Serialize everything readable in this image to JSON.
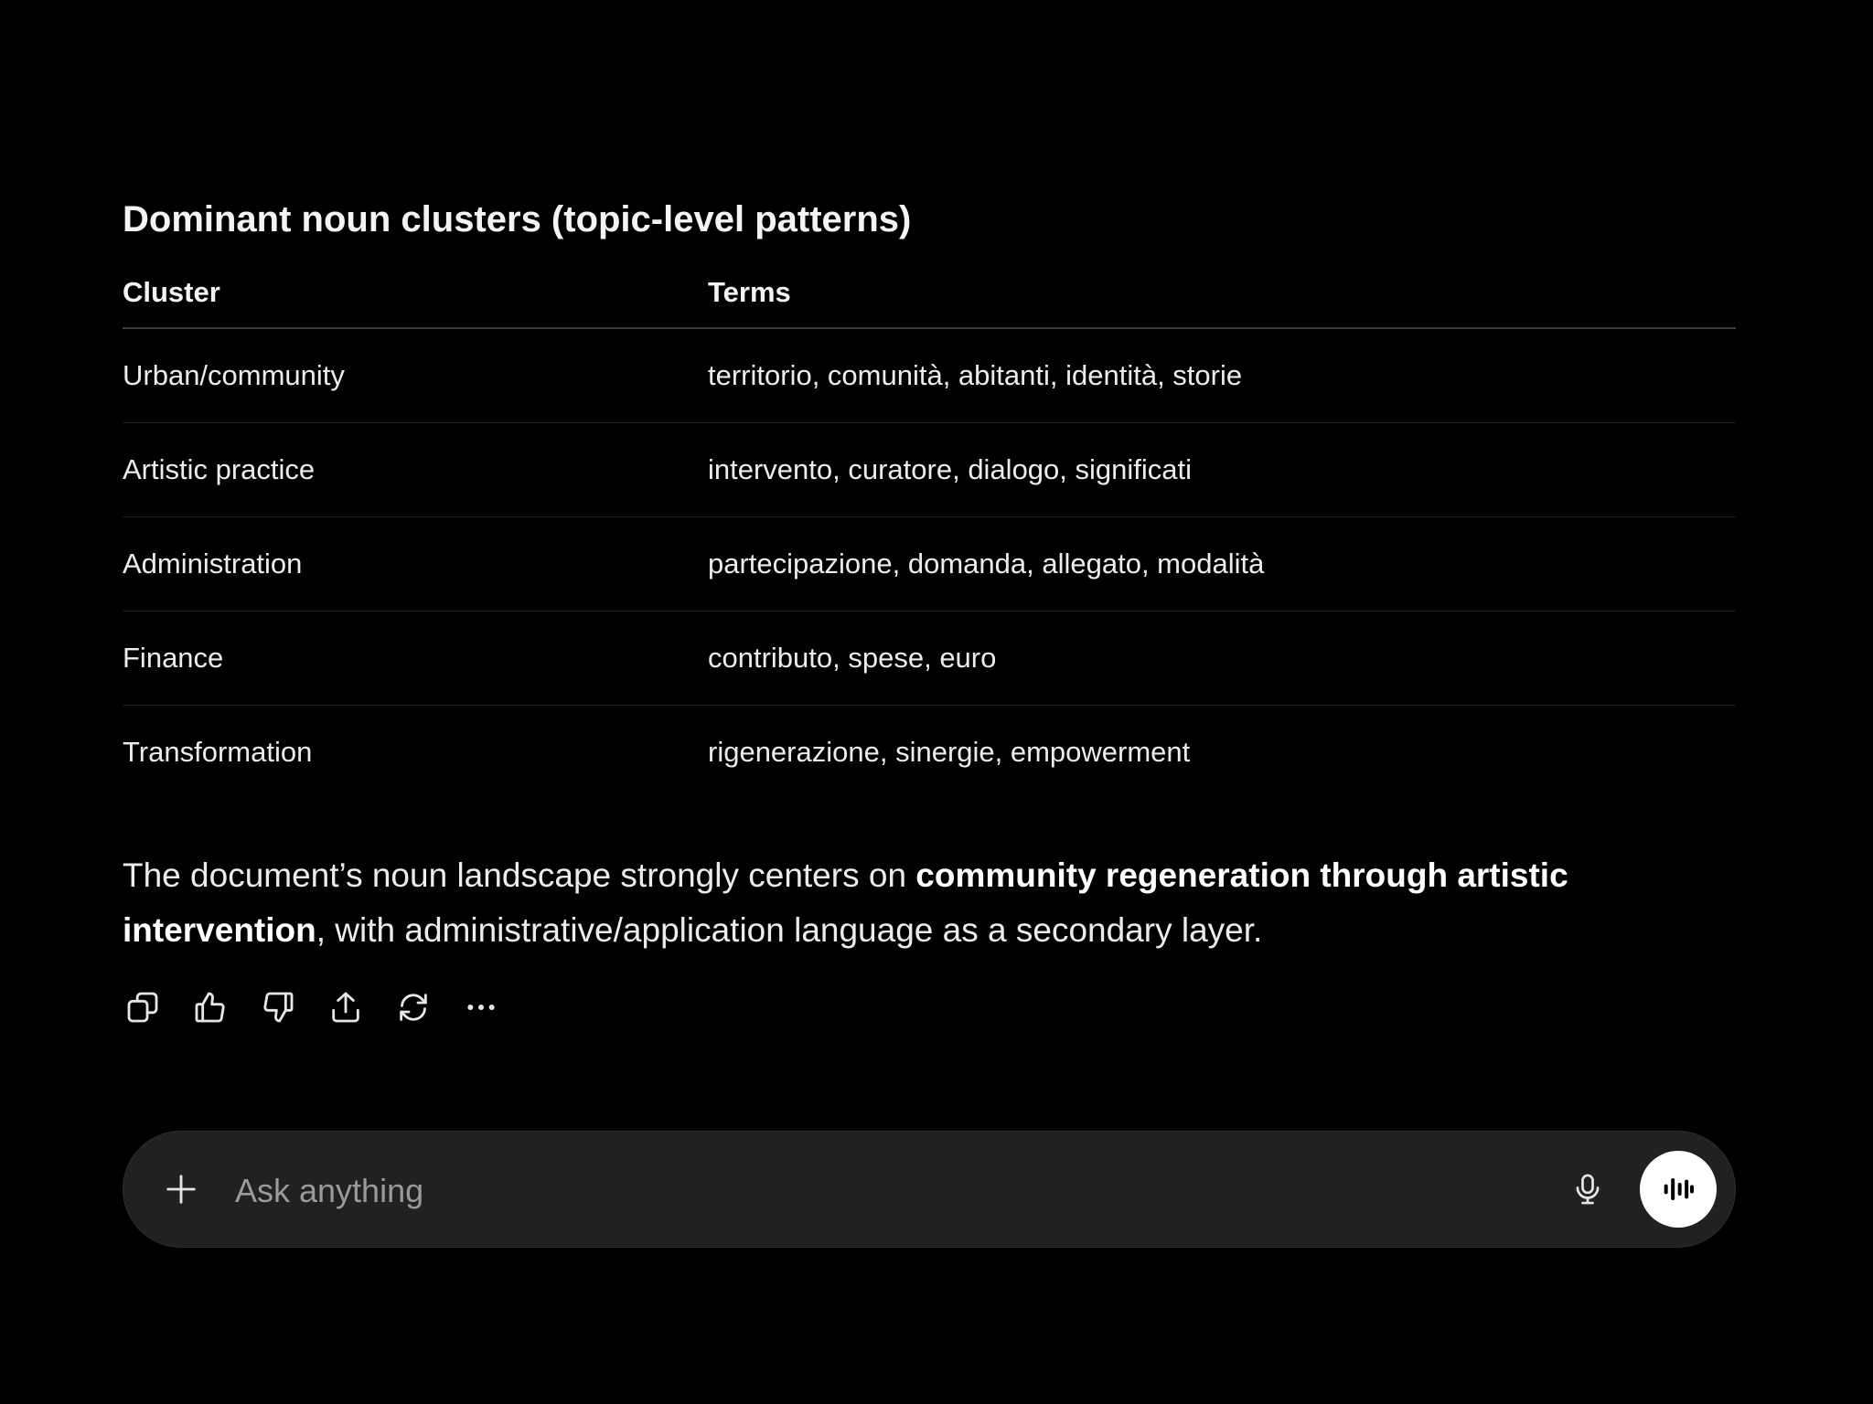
{
  "section": {
    "heading": "Dominant noun clusters (topic-level patterns)"
  },
  "table": {
    "headers": [
      "Cluster",
      "Terms"
    ],
    "rows": [
      [
        "Urban/community",
        "territorio, comunità, abitanti, identità, storie"
      ],
      [
        "Artistic practice",
        "intervento, curatore, dialogo, significati"
      ],
      [
        "Administration",
        "partecipazione, domanda, allegato, modalità"
      ],
      [
        "Finance",
        "contributo, spese, euro"
      ],
      [
        "Transformation",
        "rigenerazione, sinergie, empowerment"
      ]
    ]
  },
  "summary": {
    "part1": "The document’s noun landscape strongly centers on ",
    "bold": "community regeneration through artistic intervention",
    "part2": ", with administrative/application language as a secondary layer."
  },
  "actions": [
    {
      "name": "copy",
      "icon": "copy-icon"
    },
    {
      "name": "thumbs-up",
      "icon": "thumbs-up-icon"
    },
    {
      "name": "thumbs-down",
      "icon": "thumbs-down-icon"
    },
    {
      "name": "share",
      "icon": "share-icon"
    },
    {
      "name": "regenerate",
      "icon": "refresh-icon"
    },
    {
      "name": "more",
      "icon": "more-icon"
    }
  ],
  "composer": {
    "placeholder": "Ask anything",
    "value": "",
    "plus_icon": "plus-icon",
    "mic_icon": "microphone-icon",
    "voice_icon": "voice-mode-icon"
  },
  "colors": {
    "background": "#000000",
    "text": "#ececec",
    "composer_bg": "#212121",
    "voice_button_bg": "#ffffff"
  }
}
